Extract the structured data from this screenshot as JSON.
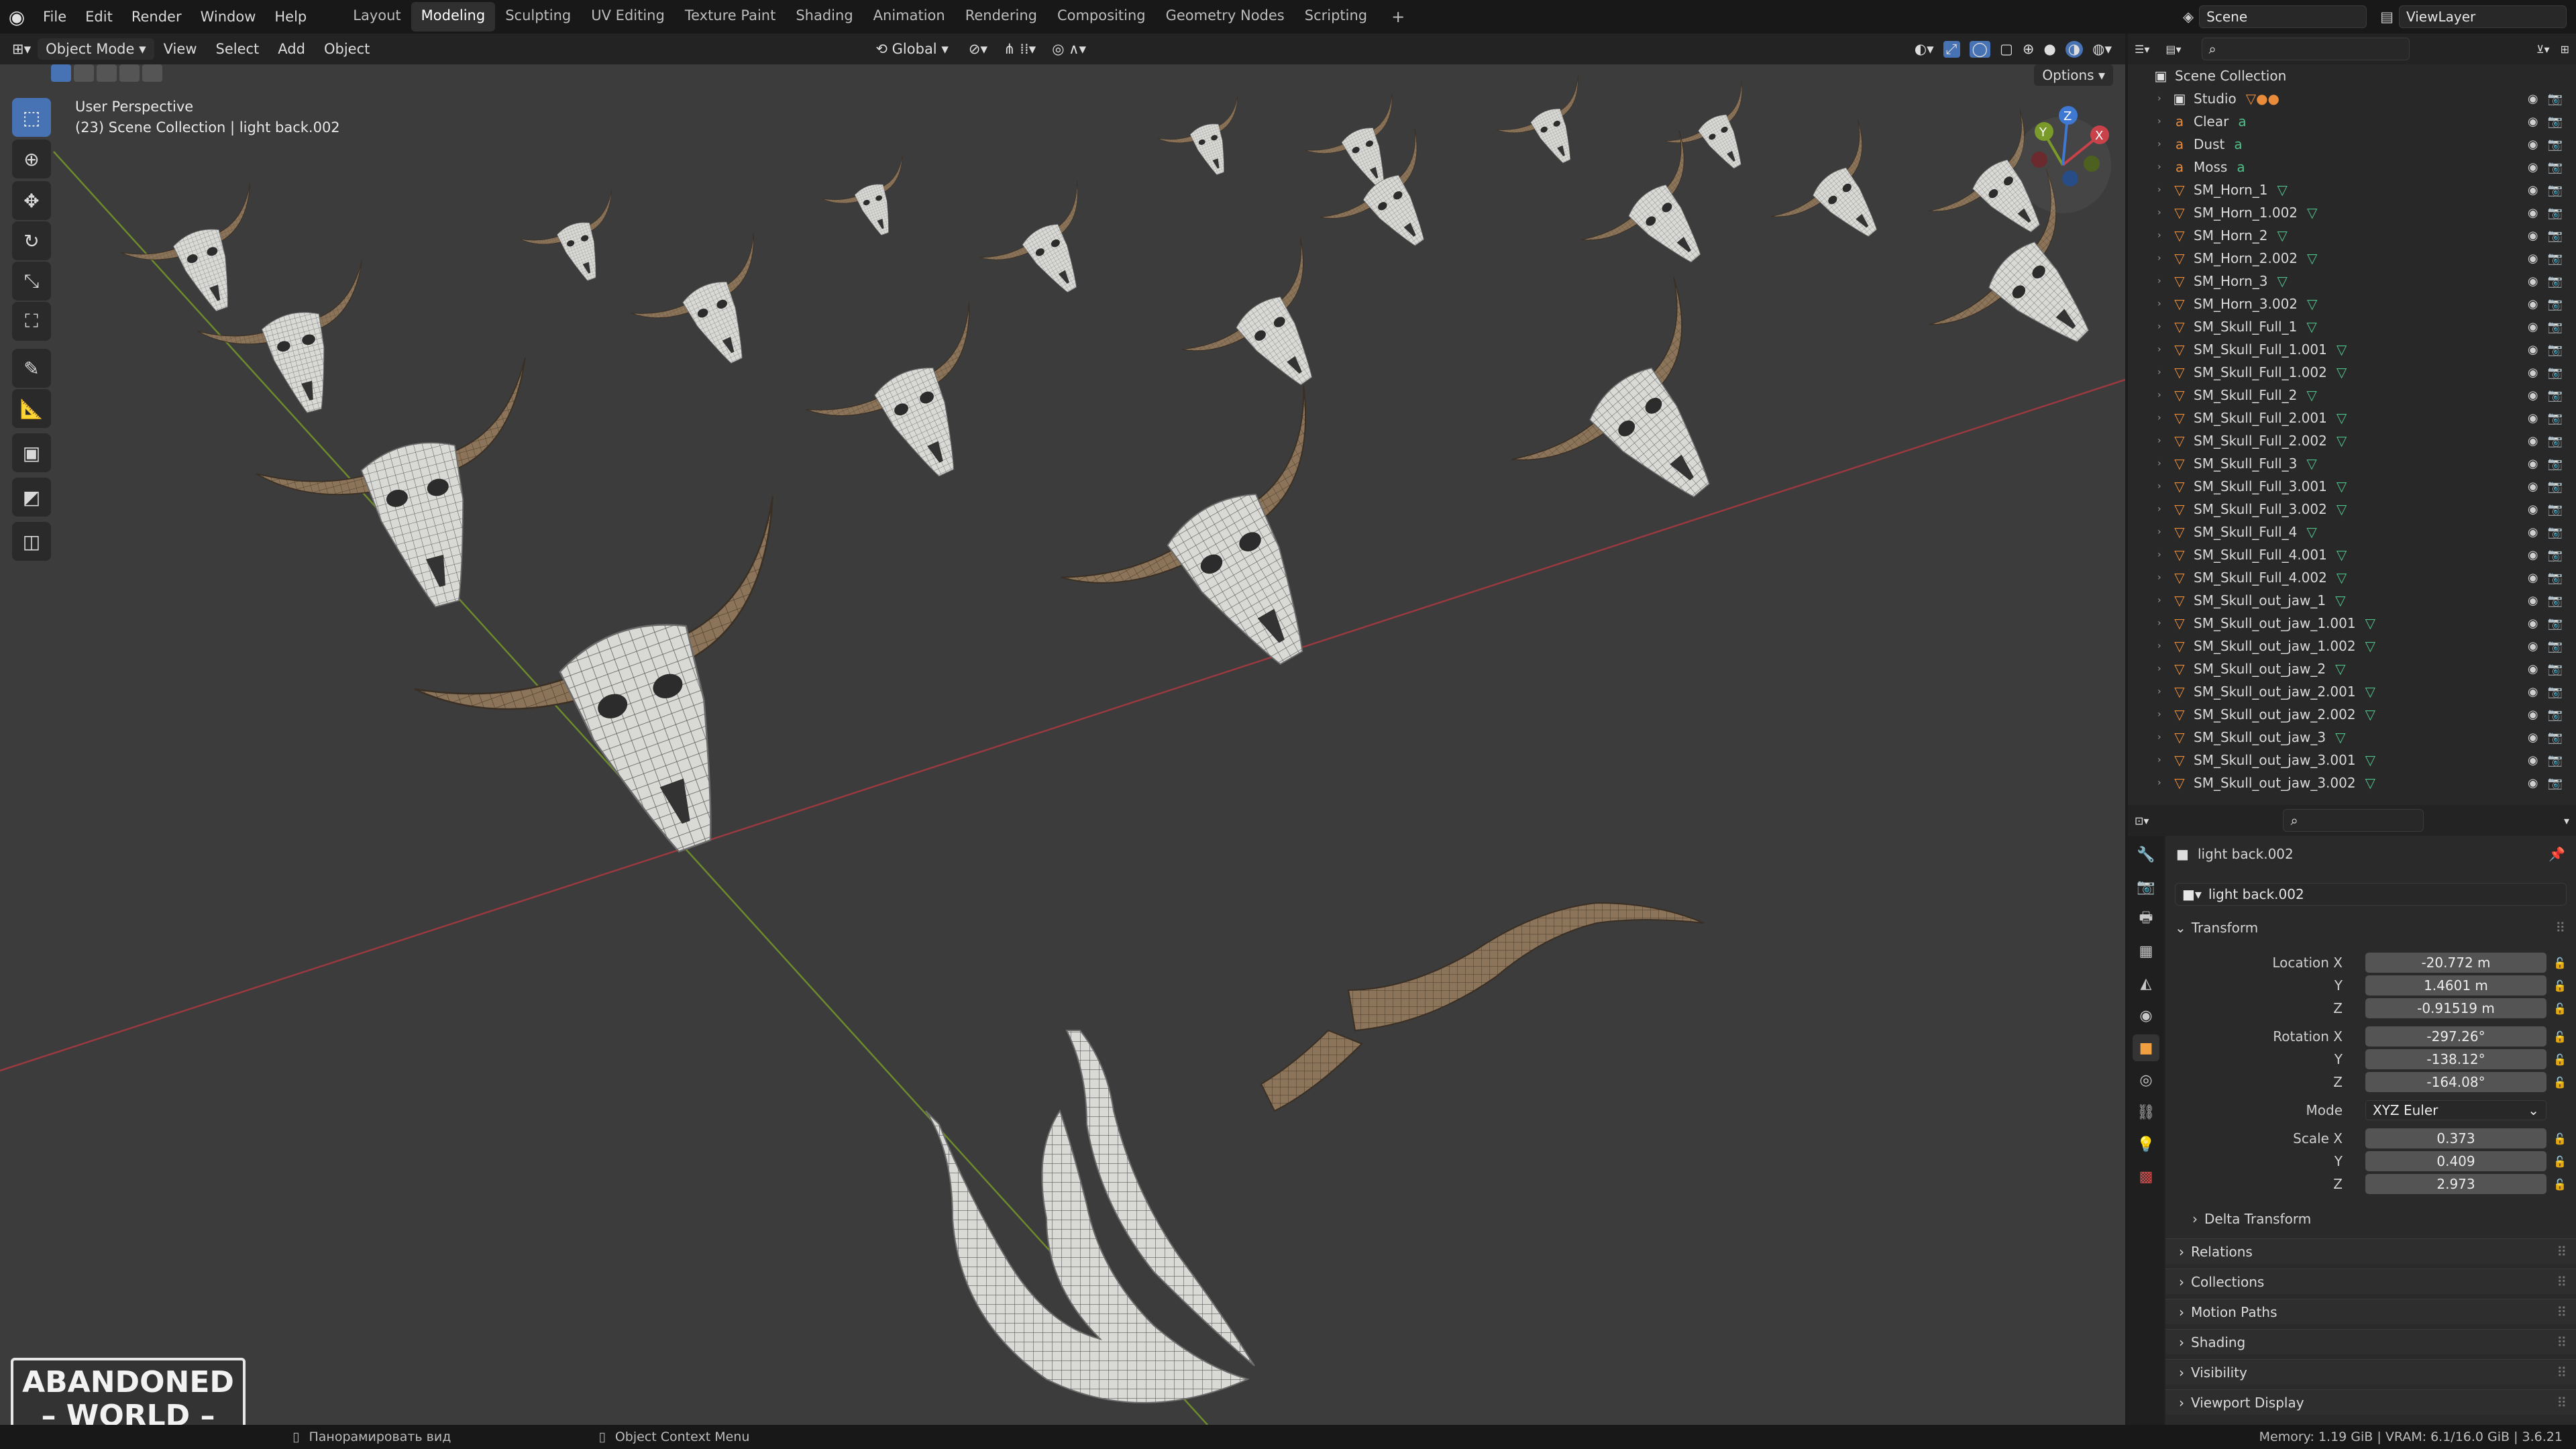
{
  "menubar": {
    "items": [
      "File",
      "Edit",
      "Render",
      "Window",
      "Help"
    ],
    "workspaces": [
      "Layout",
      "Modeling",
      "Sculpting",
      "UV Editing",
      "Texture Paint",
      "Shading",
      "Animation",
      "Rendering",
      "Compositing",
      "Geometry Nodes",
      "Scripting"
    ],
    "active_workspace": "Modeling",
    "scene_name": "Scene",
    "view_layer": "ViewLayer"
  },
  "viewport_header": {
    "mode": "Object Mode",
    "menus": [
      "View",
      "Select",
      "Add",
      "Object"
    ],
    "transform_orientation": "Global",
    "options_label": "Options"
  },
  "viewport": {
    "perspective_label": "User Perspective",
    "context_label": "(23) Scene Collection | light back.002",
    "gizmo_axes": [
      "X",
      "Y",
      "Z"
    ]
  },
  "outliner": {
    "root": "Scene Collection",
    "rows": [
      {
        "name": "Studio",
        "type": "collection"
      },
      {
        "name": "Clear",
        "type": "material"
      },
      {
        "name": "Dust",
        "type": "material"
      },
      {
        "name": "Moss",
        "type": "material"
      },
      {
        "name": "SM_Horn_1",
        "type": "mesh"
      },
      {
        "name": "SM_Horn_1.002",
        "type": "mesh"
      },
      {
        "name": "SM_Horn_2",
        "type": "mesh"
      },
      {
        "name": "SM_Horn_2.002",
        "type": "mesh"
      },
      {
        "name": "SM_Horn_3",
        "type": "mesh"
      },
      {
        "name": "SM_Horn_3.002",
        "type": "mesh"
      },
      {
        "name": "SM_Skull_Full_1",
        "type": "mesh"
      },
      {
        "name": "SM_Skull_Full_1.001",
        "type": "mesh"
      },
      {
        "name": "SM_Skull_Full_1.002",
        "type": "mesh"
      },
      {
        "name": "SM_Skull_Full_2",
        "type": "mesh"
      },
      {
        "name": "SM_Skull_Full_2.001",
        "type": "mesh"
      },
      {
        "name": "SM_Skull_Full_2.002",
        "type": "mesh"
      },
      {
        "name": "SM_Skull_Full_3",
        "type": "mesh"
      },
      {
        "name": "SM_Skull_Full_3.001",
        "type": "mesh"
      },
      {
        "name": "SM_Skull_Full_3.002",
        "type": "mesh"
      },
      {
        "name": "SM_Skull_Full_4",
        "type": "mesh"
      },
      {
        "name": "SM_Skull_Full_4.001",
        "type": "mesh"
      },
      {
        "name": "SM_Skull_Full_4.002",
        "type": "mesh"
      },
      {
        "name": "SM_Skull_out_jaw_1",
        "type": "mesh"
      },
      {
        "name": "SM_Skull_out_jaw_1.001",
        "type": "mesh"
      },
      {
        "name": "SM_Skull_out_jaw_1.002",
        "type": "mesh"
      },
      {
        "name": "SM_Skull_out_jaw_2",
        "type": "mesh"
      },
      {
        "name": "SM_Skull_out_jaw_2.001",
        "type": "mesh"
      },
      {
        "name": "SM_Skull_out_jaw_2.002",
        "type": "mesh"
      },
      {
        "name": "SM_Skull_out_jaw_3",
        "type": "mesh"
      },
      {
        "name": "SM_Skull_out_jaw_3.001",
        "type": "mesh"
      },
      {
        "name": "SM_Skull_out_jaw_3.002",
        "type": "mesh"
      }
    ]
  },
  "properties": {
    "object_name": "light back.002",
    "data_name": "light back.002",
    "transform_label": "Transform",
    "location": {
      "label": "Location X",
      "x": "-20.772 m",
      "y": "1.4601 m",
      "z": "-0.91519 m"
    },
    "rotation": {
      "label": "Rotation X",
      "x": "-297.26°",
      "y": "-138.12°",
      "z": "-164.08°"
    },
    "mode": {
      "label": "Mode",
      "value": "XYZ Euler"
    },
    "scale": {
      "label": "Scale X",
      "x": "0.373",
      "y": "0.409",
      "z": "2.973"
    },
    "axis_labels": {
      "y": "Y",
      "z": "Z"
    },
    "delta_transform": "Delta Transform",
    "panels": [
      "Relations",
      "Collections",
      "Motion Paths",
      "Shading",
      "Visibility",
      "Viewport Display"
    ]
  },
  "statusbar": {
    "pan_view": "Панорамировать вид",
    "context_menu": "Object Context Menu",
    "stats": "Memory: 1.19 GiB | VRAM: 6.1/16.0 GiB | 3.6.21"
  },
  "watermark": {
    "line1": "ABANDONED",
    "line2": "WORLD"
  },
  "colors": {
    "accent": "#4772b3",
    "mesh_icon": "#e88b3b",
    "material_icon": "#4fc08a",
    "x_axis": "#c9424a",
    "y_axis": "#7a9a2a",
    "z_axis": "#3e78d2"
  }
}
